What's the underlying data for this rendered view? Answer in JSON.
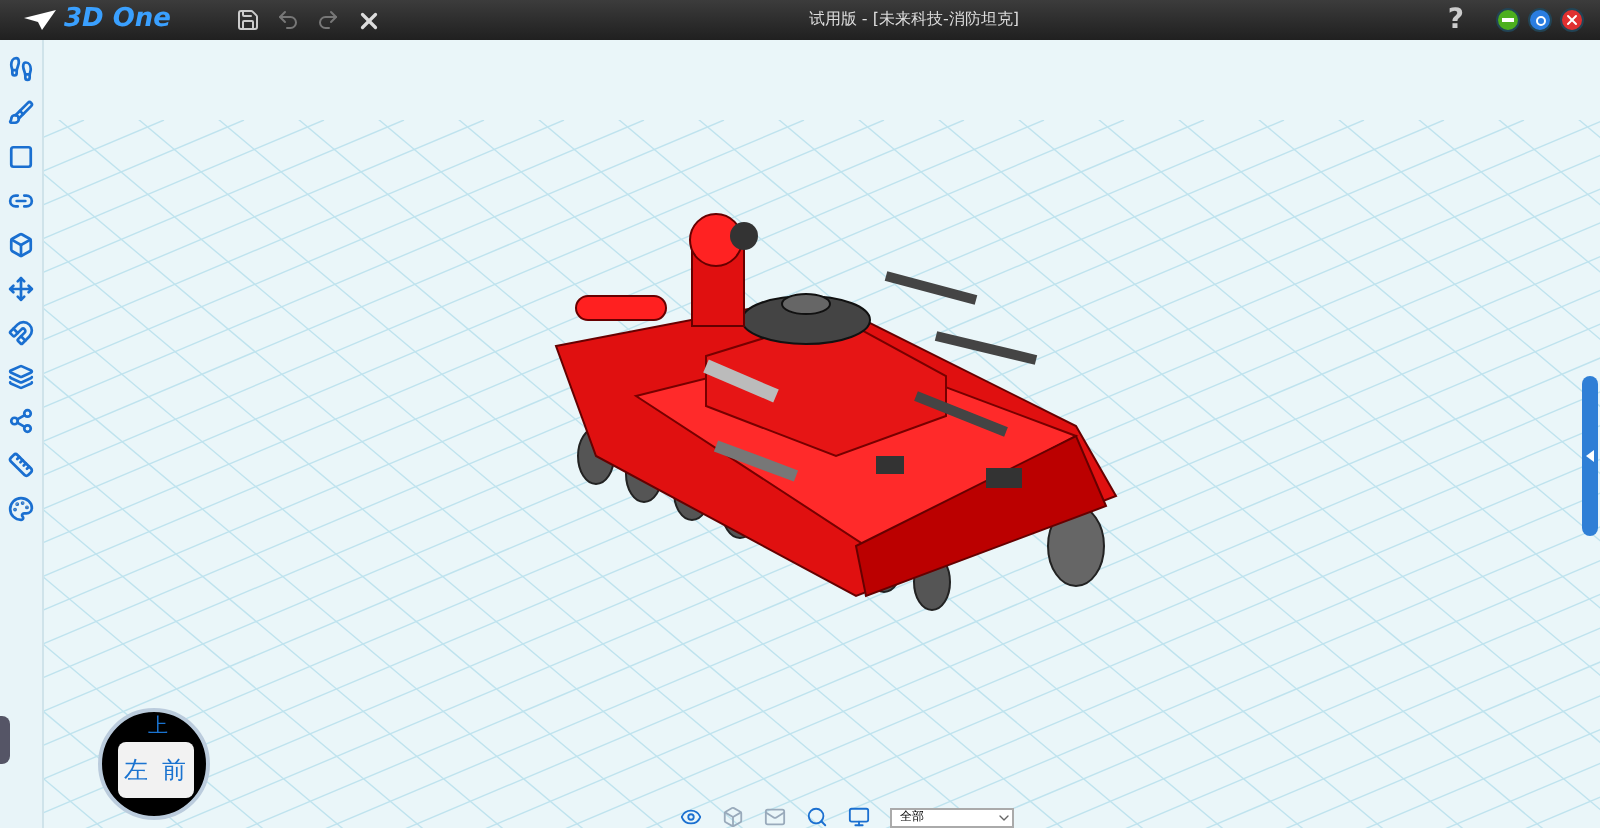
{
  "app": {
    "logo": "3D One"
  },
  "window": {
    "title": "试用版 - [未来科技-消防坦克]",
    "help": "?"
  },
  "view_cube": {
    "faces": [
      {
        "kind": "top",
        "label": "上"
      },
      {
        "kind": "left",
        "label": "左"
      },
      {
        "kind": "front",
        "label": "前"
      }
    ]
  },
  "bottom_bar": {
    "filter": {
      "value": "全部"
    }
  }
}
